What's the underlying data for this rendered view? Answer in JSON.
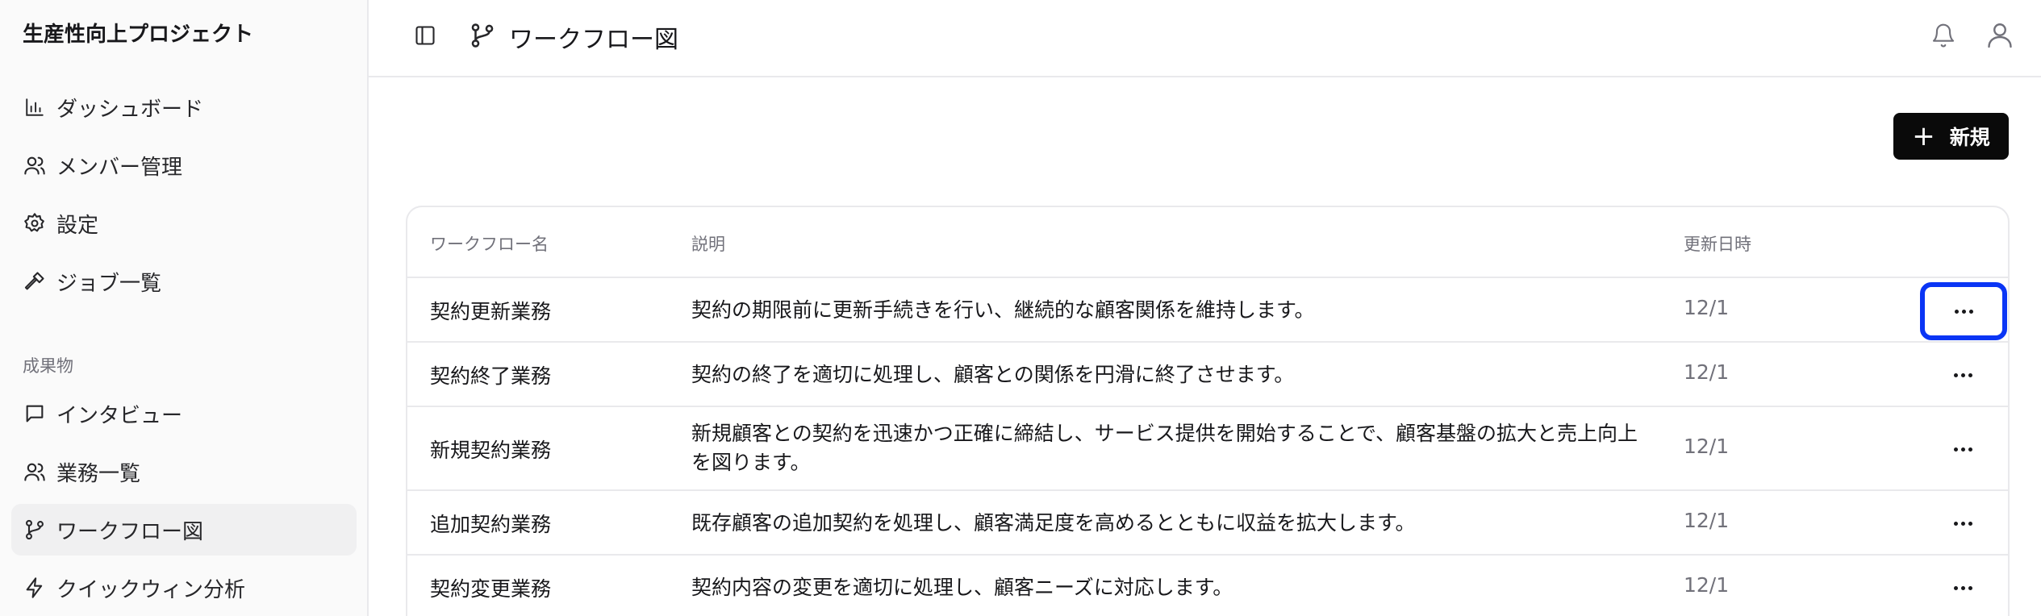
{
  "sidebar": {
    "app_title": "生産性向上プロジェクト",
    "items": [
      {
        "label": "ダッシュボード",
        "icon": "bar-chart-icon"
      },
      {
        "label": "メンバー管理",
        "icon": "users-icon"
      },
      {
        "label": "設定",
        "icon": "gear-icon"
      },
      {
        "label": "ジョブ一覧",
        "icon": "hammer-icon"
      }
    ],
    "section_label": "成果物",
    "section_items": [
      {
        "label": "インタビュー",
        "icon": "chat-icon"
      },
      {
        "label": "業務一覧",
        "icon": "users-icon"
      },
      {
        "label": "ワークフロー図",
        "icon": "git-branch-icon",
        "active": true
      },
      {
        "label": "クイックウィン分析",
        "icon": "lightning-icon"
      }
    ]
  },
  "header": {
    "title": "ワークフロー図"
  },
  "toolbar": {
    "new_label": "新規"
  },
  "table": {
    "columns": [
      "ワークフロー名",
      "説明",
      "更新日時"
    ],
    "rows": [
      {
        "name": "契約更新業務",
        "description": "契約の期限前に更新手続きを行い、継続的な顧客関係を維持します。",
        "updated": "12/1"
      },
      {
        "name": "契約終了業務",
        "description": "契約の終了を適切に処理し、顧客との関係を円滑に終了させます。",
        "updated": "12/1"
      },
      {
        "name": "新規契約業務",
        "description": "新規顧客との契約を迅速かつ正確に締結し、サービス提供を開始することで、顧客基盤の拡大と売上向上を図ります。",
        "updated": "12/1"
      },
      {
        "name": "追加契約業務",
        "description": "既存顧客の追加契約を処理し、顧客満足度を高めるとともに収益を拡大します。",
        "updated": "12/1"
      },
      {
        "name": "契約変更業務",
        "description": "契約内容の変更を適切に処理し、顧客ニーズに対応します。",
        "updated": "12/1"
      }
    ]
  },
  "colors": {
    "highlight": "#0a35f5",
    "primary_button": "#0a0a0a"
  }
}
